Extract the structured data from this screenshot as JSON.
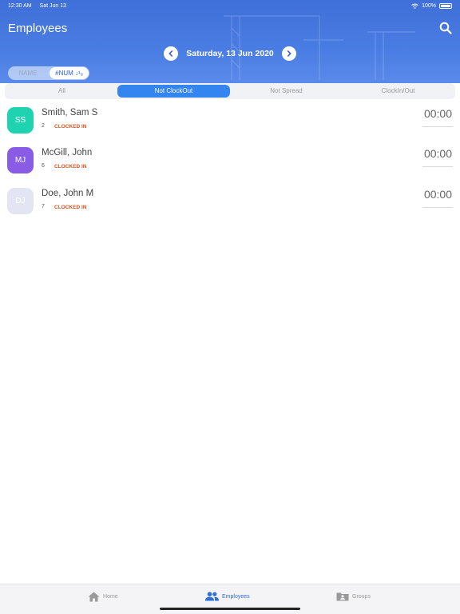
{
  "status_bar": {
    "time": "12:30 AM",
    "date": "Sat Jun 13",
    "battery": "100%"
  },
  "header": {
    "title": "Employees",
    "date": "Saturday, 13 Jun 2020",
    "accent": "#4a7de3"
  },
  "sort": {
    "name_label": "NAME",
    "num_label": "#NUM",
    "sort_glyph": "↓¹₉",
    "selected": "#NUM"
  },
  "filters": {
    "tabs": [
      "All",
      "Not ClockOut",
      "Not Spread",
      "ClockIn/Out"
    ],
    "selected": "Not ClockOut"
  },
  "employees": [
    {
      "initials": "SS",
      "name": "Smith, Sam S",
      "number": "2",
      "status": "CLOCKED IN",
      "time": "00:00",
      "color": "#1fd3b1"
    },
    {
      "initials": "MJ",
      "name": "McGill, John",
      "number": "6",
      "status": "CLOCKED IN",
      "time": "00:00",
      "color": "#8a5ce6"
    },
    {
      "initials": "DJ",
      "name": "Doe, John M",
      "number": "7",
      "status": "CLOCKED IN",
      "time": "00:00",
      "color": "#e3e6f2"
    }
  ],
  "tabbar": {
    "items": [
      "Home",
      "Employees",
      "Groups"
    ],
    "active": "Employees",
    "active_color": "#2f6fd8"
  }
}
